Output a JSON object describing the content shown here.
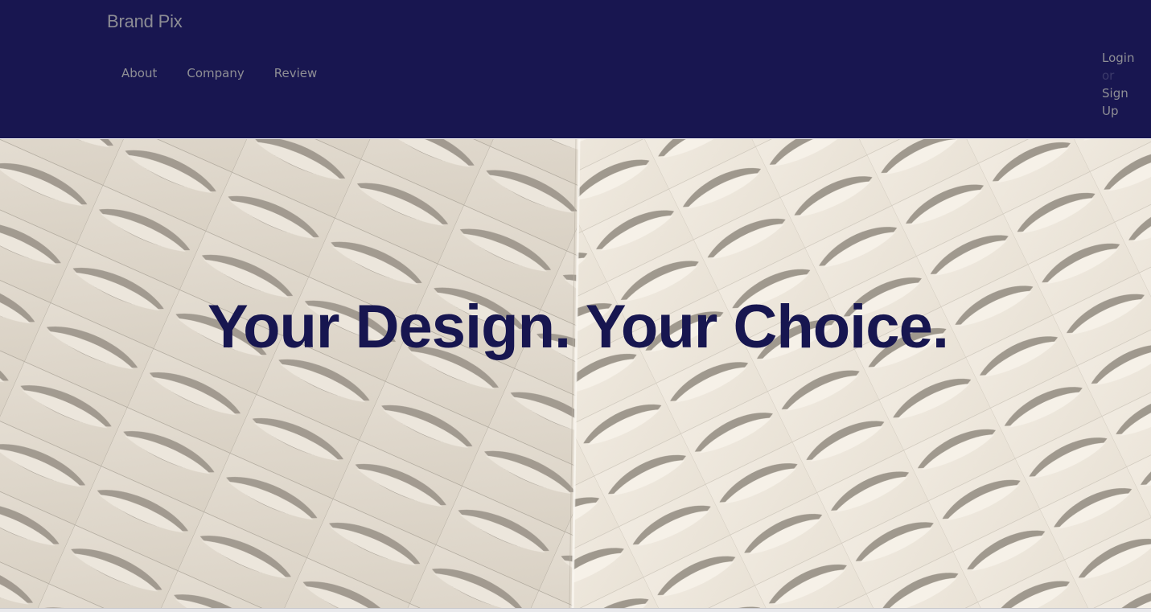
{
  "header": {
    "brand": "Brand Pix",
    "nav": [
      {
        "label": "About"
      },
      {
        "label": "Company"
      },
      {
        "label": "Review"
      }
    ],
    "auth": {
      "login": "Login",
      "or": "or",
      "signup_line1": "Sign",
      "signup_line2": "Up"
    }
  },
  "hero": {
    "title": "Your Design. Your Choice."
  },
  "colors": {
    "navbar_bg": "#181650",
    "nav_text": "#8f8f95",
    "hero_title": "#171650"
  }
}
